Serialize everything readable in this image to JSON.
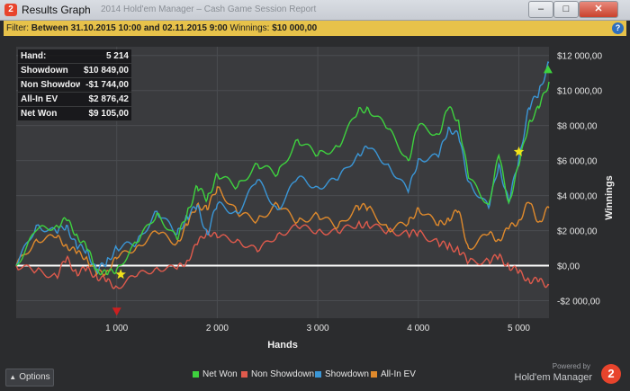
{
  "window": {
    "title": "Results Graph",
    "ghost_title": "2014 Hold'em Manager – Cash Game Session Report",
    "app_icon": "2",
    "buttons": {
      "minimize": "–",
      "maximize": "□",
      "close": "✕"
    }
  },
  "filter": {
    "prefix": "Filter:",
    "text": "Between 31.10.2015 10:00 and 02.11.2015 9:00",
    "winnings_label": "Winnings:",
    "winnings_value": "$10 000,00",
    "help_icon": "?"
  },
  "stats": [
    {
      "label": "Hand:",
      "value": "5 214"
    },
    {
      "label": "Showdown",
      "value": "$10 849,00"
    },
    {
      "label": "Non Showdown",
      "value": "-$1 744,00"
    },
    {
      "label": "All-In EV",
      "value": "$2 876,42"
    },
    {
      "label": "Net Won",
      "value": "$9 105,00"
    }
  ],
  "chart_data": {
    "type": "line",
    "xlabel": "Hands",
    "ylabel": "Winnings",
    "xlim": [
      0,
      5300
    ],
    "ylim": [
      -3000,
      12500
    ],
    "x_ticks": [
      1000,
      2000,
      3000,
      4000,
      5000
    ],
    "x_tick_labels": [
      "1 000",
      "2 000",
      "3 000",
      "4 000",
      "5 000"
    ],
    "y_ticks": [
      -2000,
      0,
      2000,
      4000,
      6000,
      8000,
      10000,
      12000
    ],
    "y_tick_labels": [
      "-$2 000,00",
      "$0,00",
      "$2 000,00",
      "$4 000,00",
      "$6 000,00",
      "$8 000,00",
      "$10 000,00",
      "$12 000,00"
    ],
    "grid": true,
    "x": [
      0,
      200,
      400,
      500,
      600,
      700,
      800,
      900,
      1000,
      1200,
      1400,
      1600,
      1700,
      1800,
      1900,
      2000,
      2200,
      2400,
      2600,
      2800,
      3000,
      3200,
      3400,
      3500,
      3700,
      3900,
      4000,
      4200,
      4300,
      4400,
      4500,
      4700,
      4800,
      4900,
      5000,
      5100,
      5200,
      5300
    ],
    "series": [
      {
        "name": "Net Won",
        "color": "#3ed23e",
        "values": [
          0,
          2000,
          2300,
          2600,
          1800,
          1000,
          -200,
          -500,
          -200,
          1300,
          3000,
          1500,
          3000,
          4500,
          3800,
          5200,
          4500,
          5800,
          5200,
          7200,
          6300,
          6800,
          8800,
          9000,
          7800,
          6000,
          8000,
          7500,
          9000,
          8300,
          5000,
          3500,
          6300,
          3600,
          5700,
          8200,
          9000,
          10500
        ]
      },
      {
        "name": "Non Showdown",
        "color": "#e05a4c",
        "values": [
          0,
          -300,
          -600,
          400,
          -400,
          -200,
          -600,
          -900,
          -1200,
          -600,
          -100,
          -200,
          300,
          1200,
          2000,
          1600,
          1500,
          800,
          1800,
          2200,
          2000,
          1900,
          2400,
          2300,
          2000,
          1800,
          1900,
          1300,
          1100,
          900,
          200,
          300,
          500,
          0,
          -400,
          -800,
          -900,
          -1100
        ]
      },
      {
        "name": "Showdown",
        "color": "#3a96d6",
        "values": [
          0,
          2300,
          1900,
          2300,
          1100,
          900,
          -300,
          200,
          1000,
          1300,
          3100,
          1800,
          2800,
          3400,
          1800,
          3500,
          3000,
          4900,
          3200,
          5000,
          4500,
          4900,
          6400,
          6700,
          5800,
          4200,
          6100,
          6200,
          7900,
          7400,
          4800,
          3300,
          5800,
          3600,
          6100,
          9000,
          9900,
          11600
        ]
      },
      {
        "name": "All-In EV",
        "color": "#e08a2c",
        "values": [
          0,
          1500,
          1600,
          1200,
          700,
          500,
          -500,
          -300,
          400,
          1100,
          1900,
          1300,
          2300,
          3500,
          3200,
          4500,
          3000,
          2600,
          3500,
          2500,
          2900,
          2200,
          3400,
          3300,
          2100,
          2400,
          3300,
          2300,
          2700,
          3100,
          1000,
          1800,
          1500,
          2100,
          2600,
          3600,
          2500,
          3300
        ]
      }
    ],
    "markers": [
      {
        "type": "triangle-down",
        "color": "#cc2020",
        "x": 1000,
        "y": -2600
      },
      {
        "type": "star",
        "color": "#f2e31a",
        "x": 1040,
        "y": -500
      },
      {
        "type": "star",
        "color": "#f2e31a",
        "x": 5000,
        "y": 6500
      },
      {
        "type": "triangle-up",
        "color": "#3ed23e",
        "x": 5290,
        "y": 11200
      }
    ]
  },
  "footer": {
    "options_label": "Options",
    "options_icon": "chevron-up-icon",
    "powered_by": "Powered by",
    "brand": "Hold'em Manager",
    "brand_logo": "2"
  }
}
